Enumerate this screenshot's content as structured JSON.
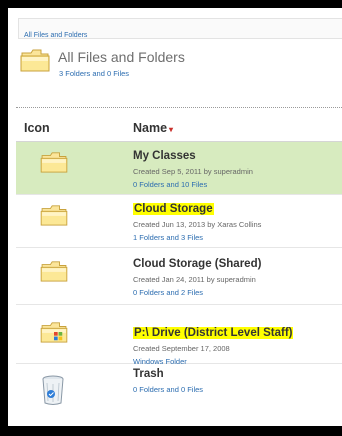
{
  "breadcrumb": {
    "label": "All Files and Folders"
  },
  "header": {
    "title": "All Files and Folders",
    "subtitle": "3 Folders and 0 Files"
  },
  "columns": {
    "icon": "Icon",
    "name": "Name",
    "sort_glyph": "▾"
  },
  "rows": [
    {
      "icon": "folder-icon",
      "name": "My Classes",
      "meta": "Created Sep 5, 2011 by superadmin",
      "count": "0 Folders and 10 Files",
      "selected": true,
      "highlight": false
    },
    {
      "icon": "folder-icon",
      "name": "Cloud Storage",
      "meta": "Created Jun 13, 2013 by Xaras Collins",
      "count": "1 Folders and 3 Files",
      "selected": false,
      "highlight": true
    },
    {
      "icon": "folder-icon",
      "name": "Cloud Storage (Shared)",
      "meta": "Created Jan 24, 2011 by superadmin",
      "count": "0 Folders and 2 Files",
      "selected": false,
      "highlight": false
    },
    {
      "icon": "windows-folder-icon",
      "name": "P:\\ Drive (District Level Staff)",
      "meta": "Created September 17, 2008",
      "count": "Windows Folder",
      "selected": false,
      "highlight": true
    },
    {
      "icon": "trash-icon",
      "name": "Trash",
      "meta": "",
      "count": "0 Folders and 0 Files",
      "selected": false,
      "highlight": false
    }
  ],
  "colors": {
    "link": "#2c6db0",
    "selected_row": "#d7ebbf",
    "highlight": "#ffff00",
    "sort_arrow": "#c9302c"
  }
}
